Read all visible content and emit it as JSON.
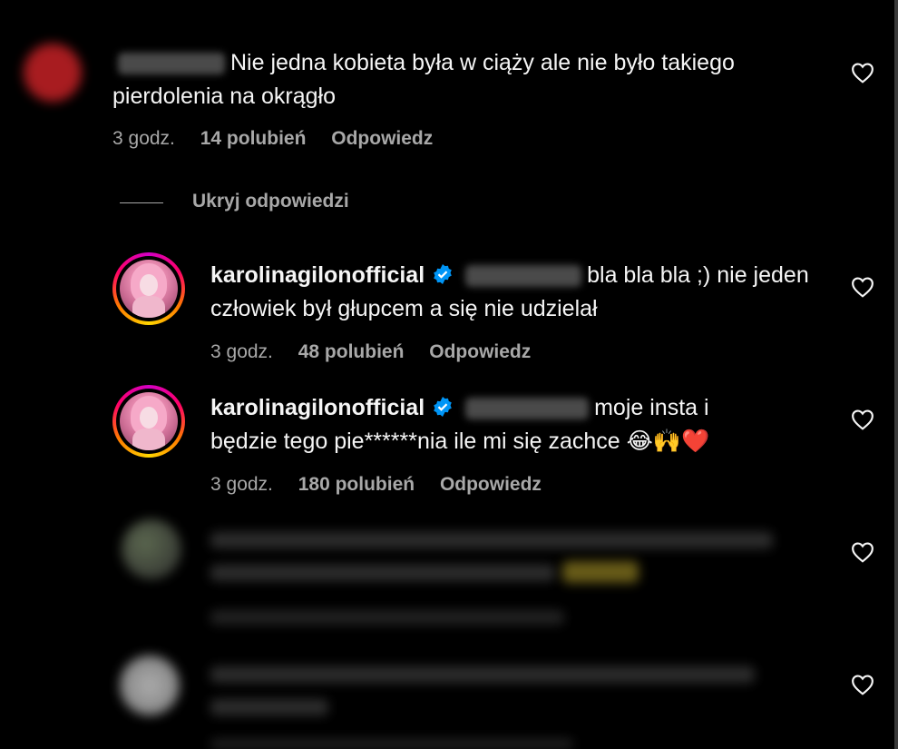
{
  "colors": {
    "background": "#000000",
    "text": "#f5f5f5",
    "secondary": "#a8a8a8",
    "verified": "#0095f6",
    "avatar_red": "#e0262b"
  },
  "comment1": {
    "text": "Nie jedna kobieta była w ciąży ale nie było takiego pierdolenia na okrągło",
    "time": "3 godz.",
    "likes": "14 polubień",
    "reply": "Odpowiedz"
  },
  "replies_toggle": "Ukryj odpowiedzi",
  "reply1": {
    "username": "karolinagilonofficial",
    "text": "bla bla bla ;) nie jeden człowiek był głupcem a się nie udzielał",
    "time": "3 godz.",
    "likes": "48 polubień",
    "reply": "Odpowiedz"
  },
  "reply2": {
    "username": "karolinagilonofficial",
    "text_line1": "moje insta i",
    "text_line2": "będzie tego pie******nia ile mi się zachce 😂🙌❤️",
    "time": "3 godz.",
    "likes": "180 polubień",
    "reply": "Odpowiedz"
  },
  "icons": [
    "heart-outline-icon",
    "verified-badge-icon"
  ]
}
